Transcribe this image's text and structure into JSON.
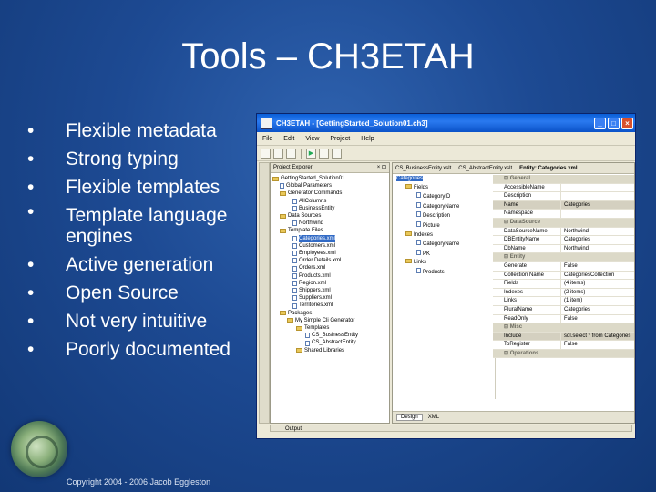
{
  "slide": {
    "title": "Tools – CH3ETAH",
    "bullets": [
      "Flexible metadata",
      "Strong typing",
      "Flexible templates",
      "Template language engines",
      "Active generation",
      "Open Source",
      "Not very intuitive",
      "Poorly documented"
    ],
    "footer": "Copyright 2004 - 2006 Jacob Eggleston"
  },
  "window": {
    "title": "CH3ETAH - [GettingStarted_Solution01.ch3]",
    "menu": [
      "File",
      "Edit",
      "View",
      "Project",
      "Help"
    ],
    "explorer_title": "Project Explorer",
    "explorer_tree": [
      "GettingStarted_Solution01",
      "Global Parameters",
      "Generator Commands",
      "AllColumns",
      "BusinessEntity",
      "Data Sources",
      "Northwind",
      "Template Files",
      "Categories.xml",
      "Customers.xml",
      "Employees.xml",
      "Order Details.xml",
      "Orders.xml",
      "Products.xml",
      "Region.xml",
      "Shippers.xml",
      "Suppliers.xml",
      "Territories.xml",
      "Packages",
      "My Simple Cli Generator",
      "Templates",
      "CS_BusinessEntity",
      "CS_AbstractEntity",
      "Shared Libraries"
    ],
    "editor_tabs": [
      "CS_BusinessEntity.xslt",
      "CS_AbstractEntity.xslt",
      "Entity: Categories.xml"
    ],
    "entity_tree": [
      "Categories",
      "Fields",
      "CategoryID",
      "CategoryName",
      "Description",
      "Picture",
      "Indexes",
      "CategoryName",
      "PK",
      "Links",
      "Products"
    ],
    "properties": [
      {
        "k": "General",
        "v": "",
        "cat": true
      },
      {
        "k": "AccessibleName",
        "v": ""
      },
      {
        "k": "Description",
        "v": ""
      },
      {
        "k": "Name",
        "v": "Categories",
        "hi": true
      },
      {
        "k": "Namespace",
        "v": ""
      },
      {
        "k": "DataSource",
        "v": "",
        "cat": true
      },
      {
        "k": "DataSourceName",
        "v": "Northwind"
      },
      {
        "k": "DBEntityName",
        "v": "Categories"
      },
      {
        "k": "DbName",
        "v": "Northwind"
      },
      {
        "k": "Entity",
        "v": "",
        "cat": true
      },
      {
        "k": "Generate",
        "v": "False"
      },
      {
        "k": "Collection Name",
        "v": "CategoriesCollection"
      },
      {
        "k": "Fields",
        "v": "(4 items)"
      },
      {
        "k": "Indexes",
        "v": "(2 items)"
      },
      {
        "k": "Links",
        "v": "(1 item)"
      },
      {
        "k": "PluralName",
        "v": "Categories"
      },
      {
        "k": "ReadOnly",
        "v": "False"
      },
      {
        "k": "Misc",
        "v": "",
        "cat": true
      },
      {
        "k": "Include",
        "v": "sql.select * from Categories",
        "hi": true
      },
      {
        "k": "ToRegister",
        "v": "False"
      },
      {
        "k": "Operations",
        "v": "",
        "cat": true
      }
    ],
    "editor_bottom": [
      "Design",
      "XML"
    ],
    "output_label": "Output"
  }
}
